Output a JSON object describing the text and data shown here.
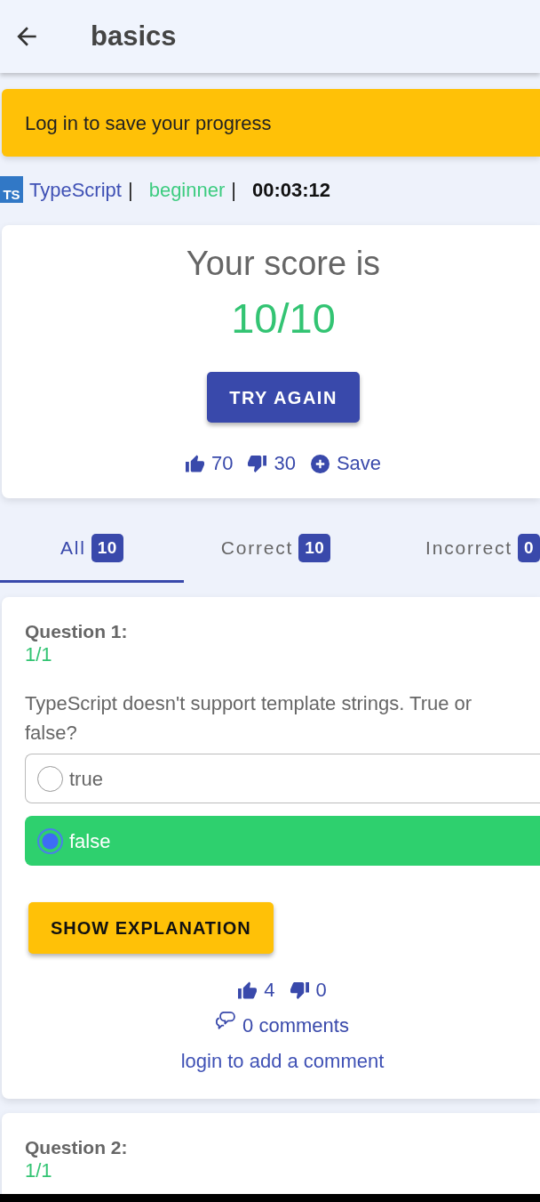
{
  "app_bar": {
    "title": "basics"
  },
  "alert": {
    "text": "Log in to save your progress"
  },
  "quiz_info": {
    "logo_text": "TS",
    "items": [
      {
        "kind": "language",
        "text": "TypeScript"
      },
      {
        "kind": "separator",
        "text": "|"
      },
      {
        "kind": "level",
        "text": "beginner"
      },
      {
        "kind": "separator",
        "text": "|"
      },
      {
        "kind": "timer",
        "text": "00:03:12"
      }
    ]
  },
  "result": {
    "heading": "Your score is",
    "score": "10/10",
    "action": "TRY AGAIN",
    "likes": "70",
    "dislikes": "30",
    "save": "Save"
  },
  "tabs": [
    {
      "label": "All",
      "count": "10",
      "selected": true
    },
    {
      "label": "Correct",
      "count": "10",
      "selected": false
    },
    {
      "label": "Incorrect",
      "count": "0",
      "selected": false
    }
  ],
  "questions": [
    {
      "title": "Question 1:",
      "points": "1/1",
      "text": "TypeScript doesn't support template strings. True or false?",
      "options": [
        {
          "label": "true",
          "selected": false,
          "correct": false
        },
        {
          "label": "false",
          "selected": true,
          "correct": true
        }
      ],
      "explanation_button": "SHOW EXPLANATION",
      "likes": "4",
      "dislikes": "0",
      "comments": "0 comments",
      "comment_link": "login to add a comment"
    },
    {
      "title": "Question 2:",
      "points": "1/1"
    }
  ]
}
